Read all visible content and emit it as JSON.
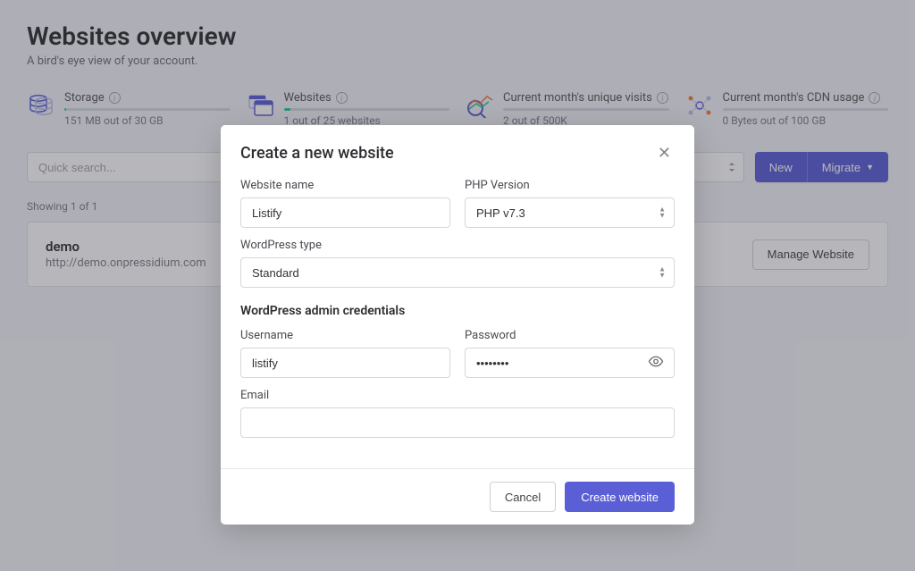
{
  "header": {
    "title": "Websites overview",
    "subtitle": "A bird's eye view of your account."
  },
  "stats": [
    {
      "label": "Storage",
      "value": "151 MB out of 30 GB",
      "fill_pct": 1
    },
    {
      "label": "Websites",
      "value": "1 out of 25 websites",
      "fill_pct": 4
    },
    {
      "label": "Current month's unique visits",
      "value": "2 out of 500K",
      "fill_pct": 0
    },
    {
      "label": "Current month's CDN usage",
      "value": "0 Bytes out of 100 GB",
      "fill_pct": 0
    }
  ],
  "toolbar": {
    "search_placeholder": "Quick search...",
    "new_label": "New",
    "migrate_label": "Migrate"
  },
  "showing_text": "Showing 1 of 1",
  "site": {
    "name": "demo",
    "url": "http://demo.onpressidium.com",
    "manage_label": "Manage Website"
  },
  "modal": {
    "title": "Create a new website",
    "website_name_label": "Website name",
    "website_name_value": "Listify",
    "php_label": "PHP Version",
    "php_value": "PHP v7.3",
    "wp_type_label": "WordPress type",
    "wp_type_value": "Standard",
    "credentials_title": "WordPress admin credentials",
    "username_label": "Username",
    "username_value": "listify",
    "password_label": "Password",
    "password_value": "••••••••",
    "email_label": "Email",
    "email_value": "",
    "cancel_label": "Cancel",
    "submit_label": "Create website"
  }
}
